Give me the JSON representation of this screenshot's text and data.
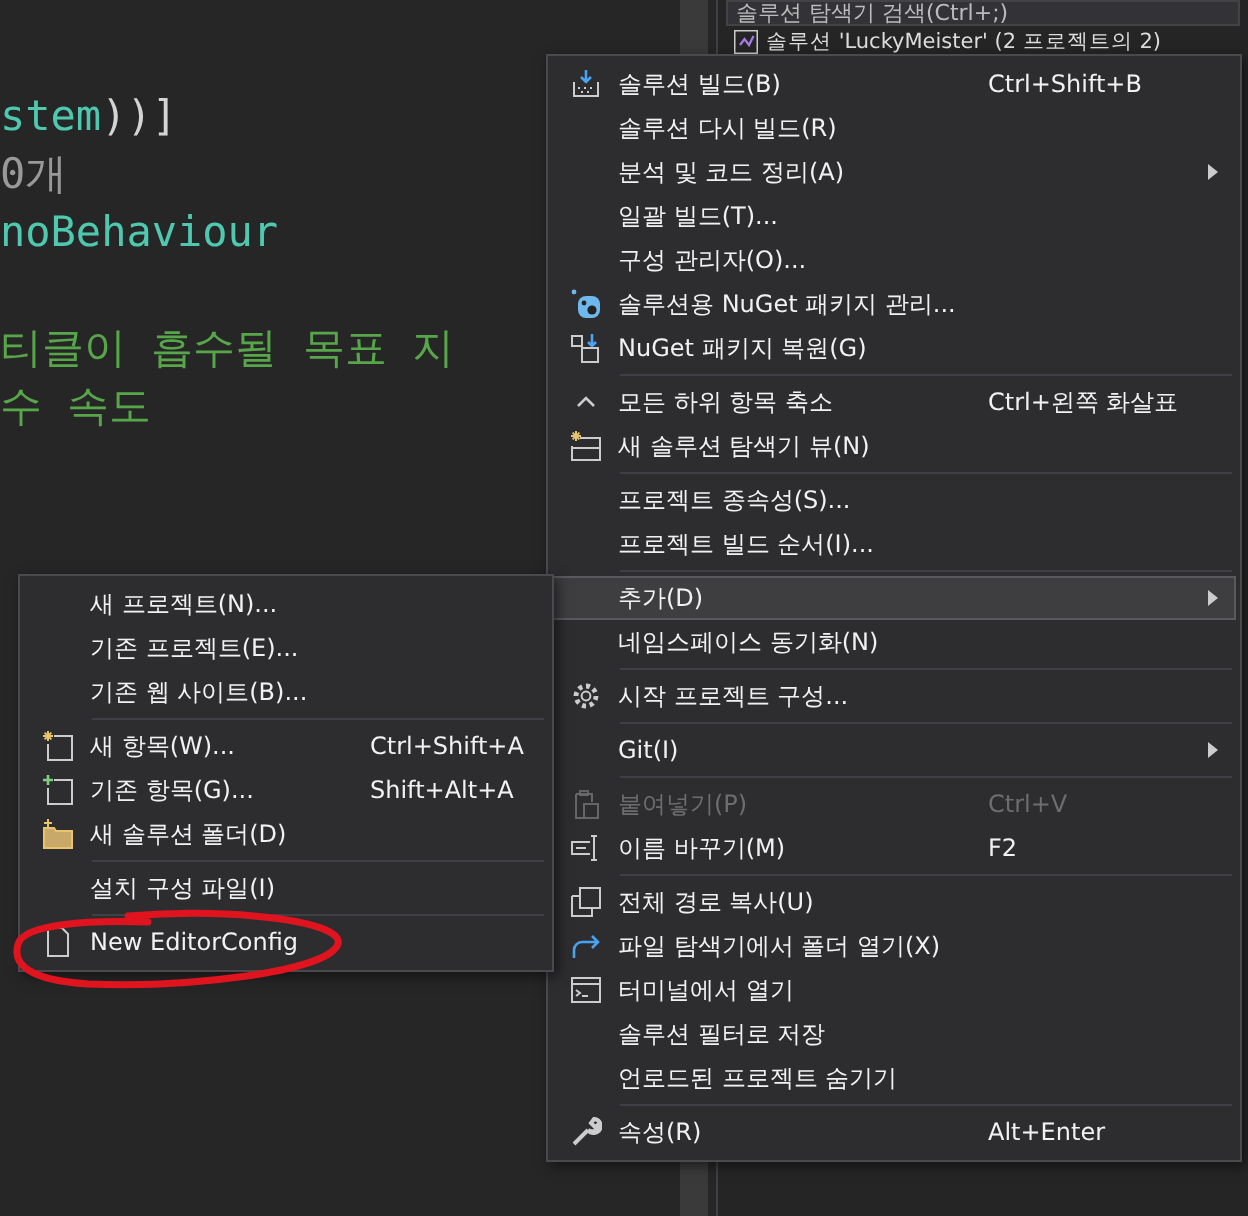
{
  "editor": {
    "lines": [
      {
        "segments": [
          {
            "kind": "type",
            "text": "stem"
          },
          {
            "kind": "plain",
            "text": "))]"
          }
        ]
      },
      {
        "segments": [
          {
            "kind": "hint",
            "text": "0개"
          }
        ]
      },
      {
        "segments": [
          {
            "kind": "type",
            "text": "noBehaviour"
          }
        ]
      },
      {
        "segments": [
          {
            "kind": "comment",
            "text": "티클이 흡수될 목표 지"
          }
        ]
      },
      {
        "segments": [
          {
            "kind": "comment",
            "text": "수 속도"
          }
        ]
      }
    ]
  },
  "solution_explorer": {
    "search": {
      "placeholder": "솔루션 탐색기 검색(Ctrl+;)"
    },
    "root": {
      "label": "솔루션 'LuckyMeister' (2 프로젝트의 2)"
    }
  },
  "context_menu": {
    "items": [
      {
        "kind": "item",
        "label": "솔루션 빌드(B)",
        "shortcut": "Ctrl+Shift+B",
        "submenu": false,
        "disabled": false,
        "selected": false
      },
      {
        "kind": "item",
        "label": "솔루션 다시 빌드(R)",
        "submenu": false,
        "disabled": false,
        "selected": false
      },
      {
        "kind": "item",
        "label": "분석 및 코드 정리(A)",
        "submenu": true,
        "disabled": false,
        "selected": false
      },
      {
        "kind": "item",
        "label": "일괄 빌드(T)...",
        "submenu": false,
        "disabled": false,
        "selected": false
      },
      {
        "kind": "item",
        "label": "구성 관리자(O)...",
        "submenu": false,
        "disabled": false,
        "selected": false
      },
      {
        "kind": "item",
        "label": "솔루션용 NuGet 패키지 관리...",
        "submenu": false,
        "disabled": false,
        "selected": false
      },
      {
        "kind": "item",
        "label": "NuGet 패키지 복원(G)",
        "submenu": false,
        "disabled": false,
        "selected": false
      },
      {
        "kind": "separator"
      },
      {
        "kind": "item",
        "label": "모든 하위 항목 축소",
        "shortcut": "Ctrl+왼쪽 화살표",
        "submenu": false,
        "disabled": false,
        "selected": false
      },
      {
        "kind": "item",
        "label": "새 솔루션 탐색기 뷰(N)",
        "submenu": false,
        "disabled": false,
        "selected": false
      },
      {
        "kind": "separator"
      },
      {
        "kind": "item",
        "label": "프로젝트 종속성(S)...",
        "submenu": false,
        "disabled": false,
        "selected": false
      },
      {
        "kind": "item",
        "label": "프로젝트 빌드 순서(I)...",
        "submenu": false,
        "disabled": false,
        "selected": false
      },
      {
        "kind": "separator"
      },
      {
        "kind": "item",
        "label": "추가(D)",
        "submenu": true,
        "disabled": false,
        "selected": true
      },
      {
        "kind": "item",
        "label": "네임스페이스 동기화(N)",
        "submenu": false,
        "disabled": false,
        "selected": false
      },
      {
        "kind": "separator"
      },
      {
        "kind": "item",
        "label": "시작 프로젝트 구성...",
        "submenu": false,
        "disabled": false,
        "selected": false
      },
      {
        "kind": "separator"
      },
      {
        "kind": "item",
        "label": "Git(I)",
        "submenu": true,
        "disabled": false,
        "selected": false
      },
      {
        "kind": "separator"
      },
      {
        "kind": "item",
        "label": "붙여넣기(P)",
        "shortcut": "Ctrl+V",
        "submenu": false,
        "disabled": true,
        "selected": false
      },
      {
        "kind": "item",
        "label": "이름 바꾸기(M)",
        "shortcut": "F2",
        "submenu": false,
        "disabled": false,
        "selected": false
      },
      {
        "kind": "separator"
      },
      {
        "kind": "item",
        "label": "전체 경로 복사(U)",
        "submenu": false,
        "disabled": false,
        "selected": false
      },
      {
        "kind": "item",
        "label": "파일 탐색기에서 폴더 열기(X)",
        "submenu": false,
        "disabled": false,
        "selected": false
      },
      {
        "kind": "item",
        "label": "터미널에서 열기",
        "submenu": false,
        "disabled": false,
        "selected": false
      },
      {
        "kind": "item",
        "label": "솔루션 필터로 저장",
        "submenu": false,
        "disabled": false,
        "selected": false
      },
      {
        "kind": "item",
        "label": "언로드된 프로젝트 숨기기",
        "submenu": false,
        "disabled": false,
        "selected": false
      },
      {
        "kind": "separator"
      },
      {
        "kind": "item",
        "label": "속성(R)",
        "shortcut": "Alt+Enter",
        "submenu": false,
        "disabled": false,
        "selected": false
      }
    ]
  },
  "add_submenu": {
    "items": [
      {
        "kind": "item",
        "label": "새 프로젝트(N)...",
        "disabled": false,
        "selected": false
      },
      {
        "kind": "item",
        "label": "기존 프로젝트(E)...",
        "disabled": false,
        "selected": false
      },
      {
        "kind": "item",
        "label": "기존 웹 사이트(B)...",
        "disabled": false,
        "selected": false
      },
      {
        "kind": "separator"
      },
      {
        "kind": "item",
        "label": "새 항목(W)...",
        "shortcut": "Ctrl+Shift+A",
        "disabled": false,
        "selected": false
      },
      {
        "kind": "item",
        "label": "기존 항목(G)...",
        "shortcut": "Shift+Alt+A",
        "disabled": false,
        "selected": false
      },
      {
        "kind": "item",
        "label": "새 솔루션 폴더(D)",
        "disabled": false,
        "selected": false
      },
      {
        "kind": "separator"
      },
      {
        "kind": "item",
        "label": "설치 구성 파일(I)",
        "disabled": false,
        "selected": false
      },
      {
        "kind": "separator"
      },
      {
        "kind": "item",
        "label": "New EditorConfig",
        "disabled": false,
        "selected": false
      }
    ]
  }
}
